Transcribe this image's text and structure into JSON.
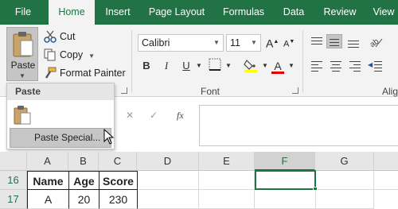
{
  "tabs": [
    "File",
    "Home",
    "Insert",
    "Page Layout",
    "Formulas",
    "Data",
    "Review",
    "View"
  ],
  "clipboard": {
    "paste_label": "Paste",
    "cut_label": "Cut",
    "copy_label": "Copy",
    "format_painter_label": "Format Painter"
  },
  "font": {
    "name": "Calibri",
    "size": "11",
    "group_label": "Font",
    "bold": "B",
    "italic": "I",
    "underline": "U",
    "font_color_letter": "A"
  },
  "alignment": {
    "group_label": "Alig"
  },
  "paste_menu": {
    "header": "Paste",
    "paste_special_label": "Paste Special..."
  },
  "formula_bar": {
    "fx": "fx",
    "cancel": "✕",
    "enter": "✓"
  },
  "grid": {
    "columns": [
      "A",
      "B",
      "C",
      "D",
      "E",
      "F",
      "G"
    ],
    "selected_column": "F",
    "rows": [
      {
        "num": "16",
        "cells": [
          "Name",
          "Age",
          "Score"
        ]
      },
      {
        "num": "17",
        "cells": [
          "A",
          "20",
          "230"
        ]
      }
    ]
  },
  "colors": {
    "accent": "#217346",
    "ribbon_bg": "#f3f3f3",
    "font_color_bar": "#e00000",
    "highlight_bar": "#ffff00"
  }
}
